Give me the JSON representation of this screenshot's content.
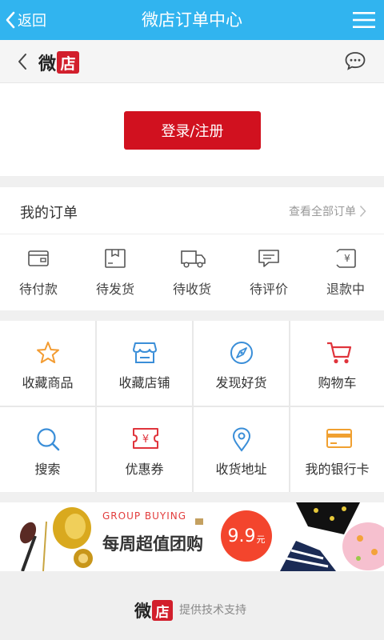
{
  "topbar": {
    "back_label": "返回",
    "title": "微店订单中心"
  },
  "brand": {
    "part1": "微",
    "part2": "店"
  },
  "login": {
    "label": "登录/注册"
  },
  "orders": {
    "title": "我的订单",
    "view_all": "查看全部订单",
    "items": [
      {
        "label": "待付款",
        "icon": "wallet-icon"
      },
      {
        "label": "待发货",
        "icon": "package-icon"
      },
      {
        "label": "待收货",
        "icon": "truck-icon"
      },
      {
        "label": "待评价",
        "icon": "comment-icon"
      },
      {
        "label": "退款中",
        "icon": "refund-icon"
      }
    ]
  },
  "grid": {
    "items": [
      {
        "label": "收藏商品",
        "icon": "star-icon",
        "color": "#f39c32"
      },
      {
        "label": "收藏店铺",
        "icon": "store-icon",
        "color": "#3a8ed8"
      },
      {
        "label": "发现好货",
        "icon": "compass-icon",
        "color": "#3a8ed8"
      },
      {
        "label": "购物车",
        "icon": "cart-icon",
        "color": "#e0343c"
      },
      {
        "label": "搜索",
        "icon": "search-icon",
        "color": "#3a8ed8"
      },
      {
        "label": "优惠券",
        "icon": "coupon-icon",
        "color": "#e0343c"
      },
      {
        "label": "收货地址",
        "icon": "location-icon",
        "color": "#3a8ed8"
      },
      {
        "label": "我的银行卡",
        "icon": "bank-card-icon",
        "color": "#f0a030"
      }
    ]
  },
  "banner": {
    "en": "GROUP BUYING",
    "cn": "每周超值团购",
    "price": "9.9",
    "unit": "元"
  },
  "footer": {
    "support": "提供技术支持"
  },
  "colors": {
    "topbar": "#31b4ef",
    "primary_red": "#d1111f"
  }
}
